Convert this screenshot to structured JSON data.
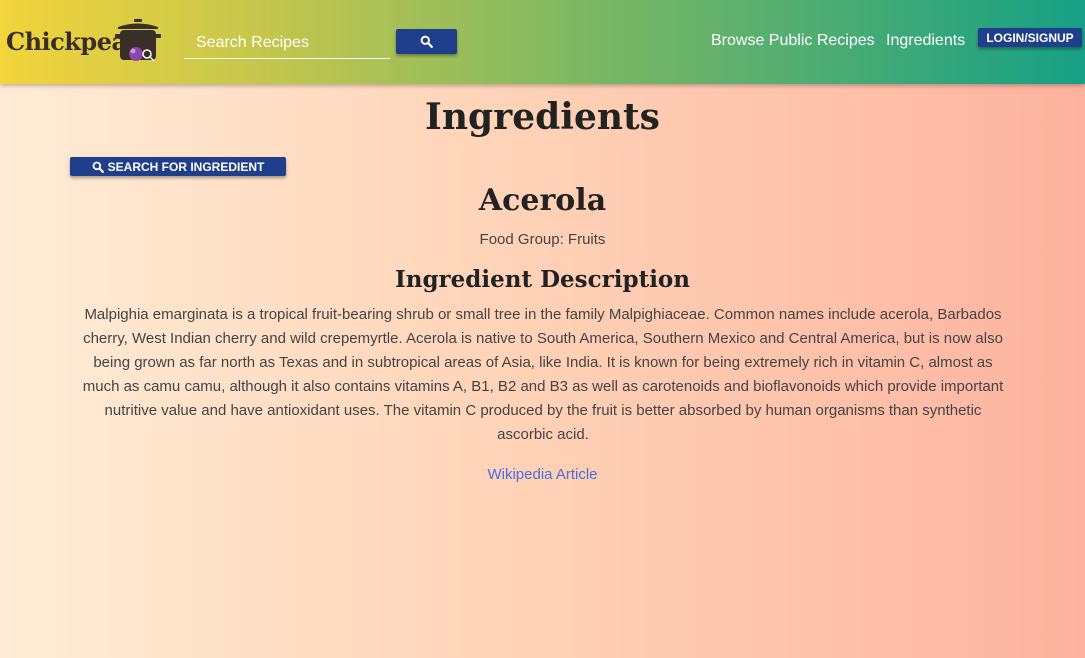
{
  "header": {
    "logo_text": "Chickpeas",
    "search": {
      "placeholder": "Search Recipes",
      "value": ""
    },
    "nav": {
      "browse_label": "Browse Public Recipes",
      "ingredients_label": "Ingredients",
      "login_label": "LOGIN/SIGNUP"
    }
  },
  "main": {
    "page_title": "Ingredients",
    "search_ingredient_label": "SEARCH FOR INGREDIENT",
    "ingredient": {
      "name": "Acerola",
      "food_group": "Food Group: Fruits",
      "description_heading": "Ingredient Description",
      "description": "Malpighia emarginata is a tropical fruit-bearing shrub or small tree in the family Malpighiaceae. Common names include acerola, Barbados cherry, West Indian cherry and wild crepemyrtle. Acerola is native to South America, Southern Mexico and Central America, but is now also being grown as far north as Texas and in subtropical areas of Asia, like India. It is known for being extremely rich in vitamin C, almost as much as camu camu, although it also contains vitamins A, B1, B2 and B3 as well as carotenoids and bioflavonoids which provide important nutritive value and have antioxidant uses. The vitamin C produced by the fruit is better absorbed by human organisms than synthetic ascorbic acid.",
      "wiki_link_label": "Wikipedia Article"
    }
  },
  "icons": {
    "logo": "cooking-pot-icon",
    "search": "search-icon"
  },
  "colors": {
    "button_blue": "#1f3f8c",
    "link_blue": "#4a6ee0"
  }
}
